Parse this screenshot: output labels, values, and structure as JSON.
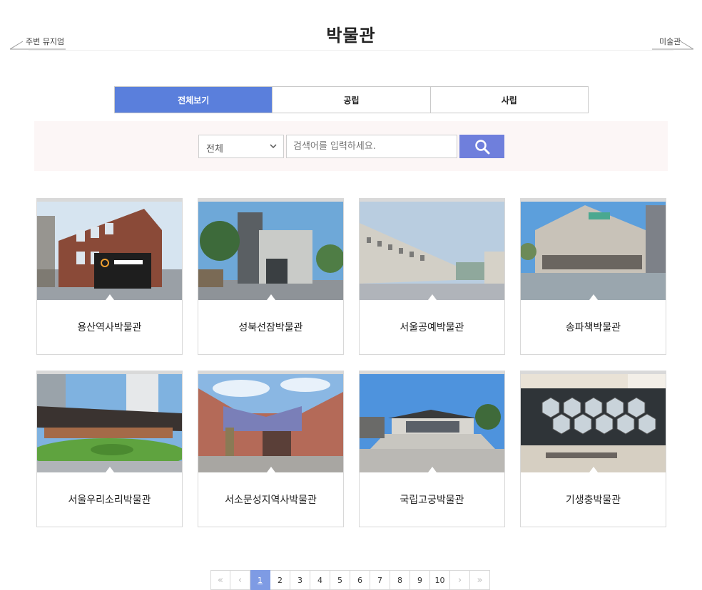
{
  "header": {
    "title": "박물관",
    "prev_link": "주변 뮤지엄",
    "next_link": "미술관"
  },
  "tabs": [
    {
      "label": "전체보기",
      "active": true
    },
    {
      "label": "공립",
      "active": false
    },
    {
      "label": "사립",
      "active": false
    }
  ],
  "search": {
    "category_selected": "전체",
    "placeholder": "검색어를 입력하세요.",
    "button_icon": "search-icon"
  },
  "museums": [
    {
      "name": "용산역사박물관"
    },
    {
      "name": "성북선잠박물관"
    },
    {
      "name": "서울공예박물관"
    },
    {
      "name": "송파책박물관"
    },
    {
      "name": "서울우리소리박물관"
    },
    {
      "name": "서소문성지역사박물관"
    },
    {
      "name": "국립고궁박물관"
    },
    {
      "name": "기생충박물관"
    }
  ],
  "pagination": {
    "first_icon": "«",
    "prev_icon": "‹",
    "pages": [
      "1",
      "2",
      "3",
      "4",
      "5",
      "6",
      "7",
      "8",
      "9",
      "10"
    ],
    "current": "1",
    "next_icon": "›",
    "last_icon": "»"
  },
  "colors": {
    "active_tab": "#5a7fdc",
    "search_button": "#6f7fdc",
    "active_page": "#7e9be4",
    "search_background": "#fcf6f6"
  }
}
